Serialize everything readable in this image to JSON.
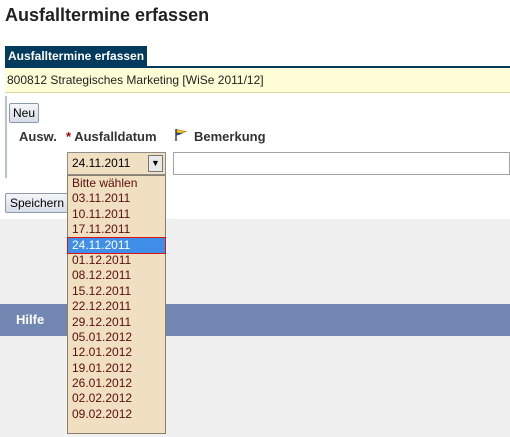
{
  "page": {
    "title": "Ausfalltermine erfassen"
  },
  "section": {
    "tab_label": "Ausfalltermine erfassen"
  },
  "course": {
    "info": "800812  Strategisches Marketing  [WiSe 2011/12]"
  },
  "toolbar": {
    "new_label": "Neu",
    "save_label": "Speichern"
  },
  "form": {
    "col_select": "Ausw.",
    "required_mark": "*",
    "col_date": "Ausfalldatum",
    "col_remark": "Bemerkung",
    "flag_icon": "flag-icon",
    "date_value": "24.11.2011",
    "remark_value": ""
  },
  "dropdown": {
    "placeholder": "Bitte wählen",
    "selected": "24.11.2011",
    "options": [
      "03.11.2011",
      "10.11.2011",
      "17.11.2011",
      "24.11.2011",
      "01.12.2011",
      "08.12.2011",
      "15.12.2011",
      "22.12.2011",
      "29.12.2011",
      "05.01.2012",
      "12.01.2012",
      "19.01.2012",
      "26.01.2012",
      "02.02.2012",
      "09.02.2012"
    ]
  },
  "help": {
    "label": "Hilfe"
  },
  "colors": {
    "section_tab": "#003a5d",
    "course_bar": "#fffdd6",
    "help_bar": "#7287b1",
    "dropdown_bg": "#f1dfc1",
    "selected_option": "#3f8fe8",
    "required": "#b00000"
  }
}
